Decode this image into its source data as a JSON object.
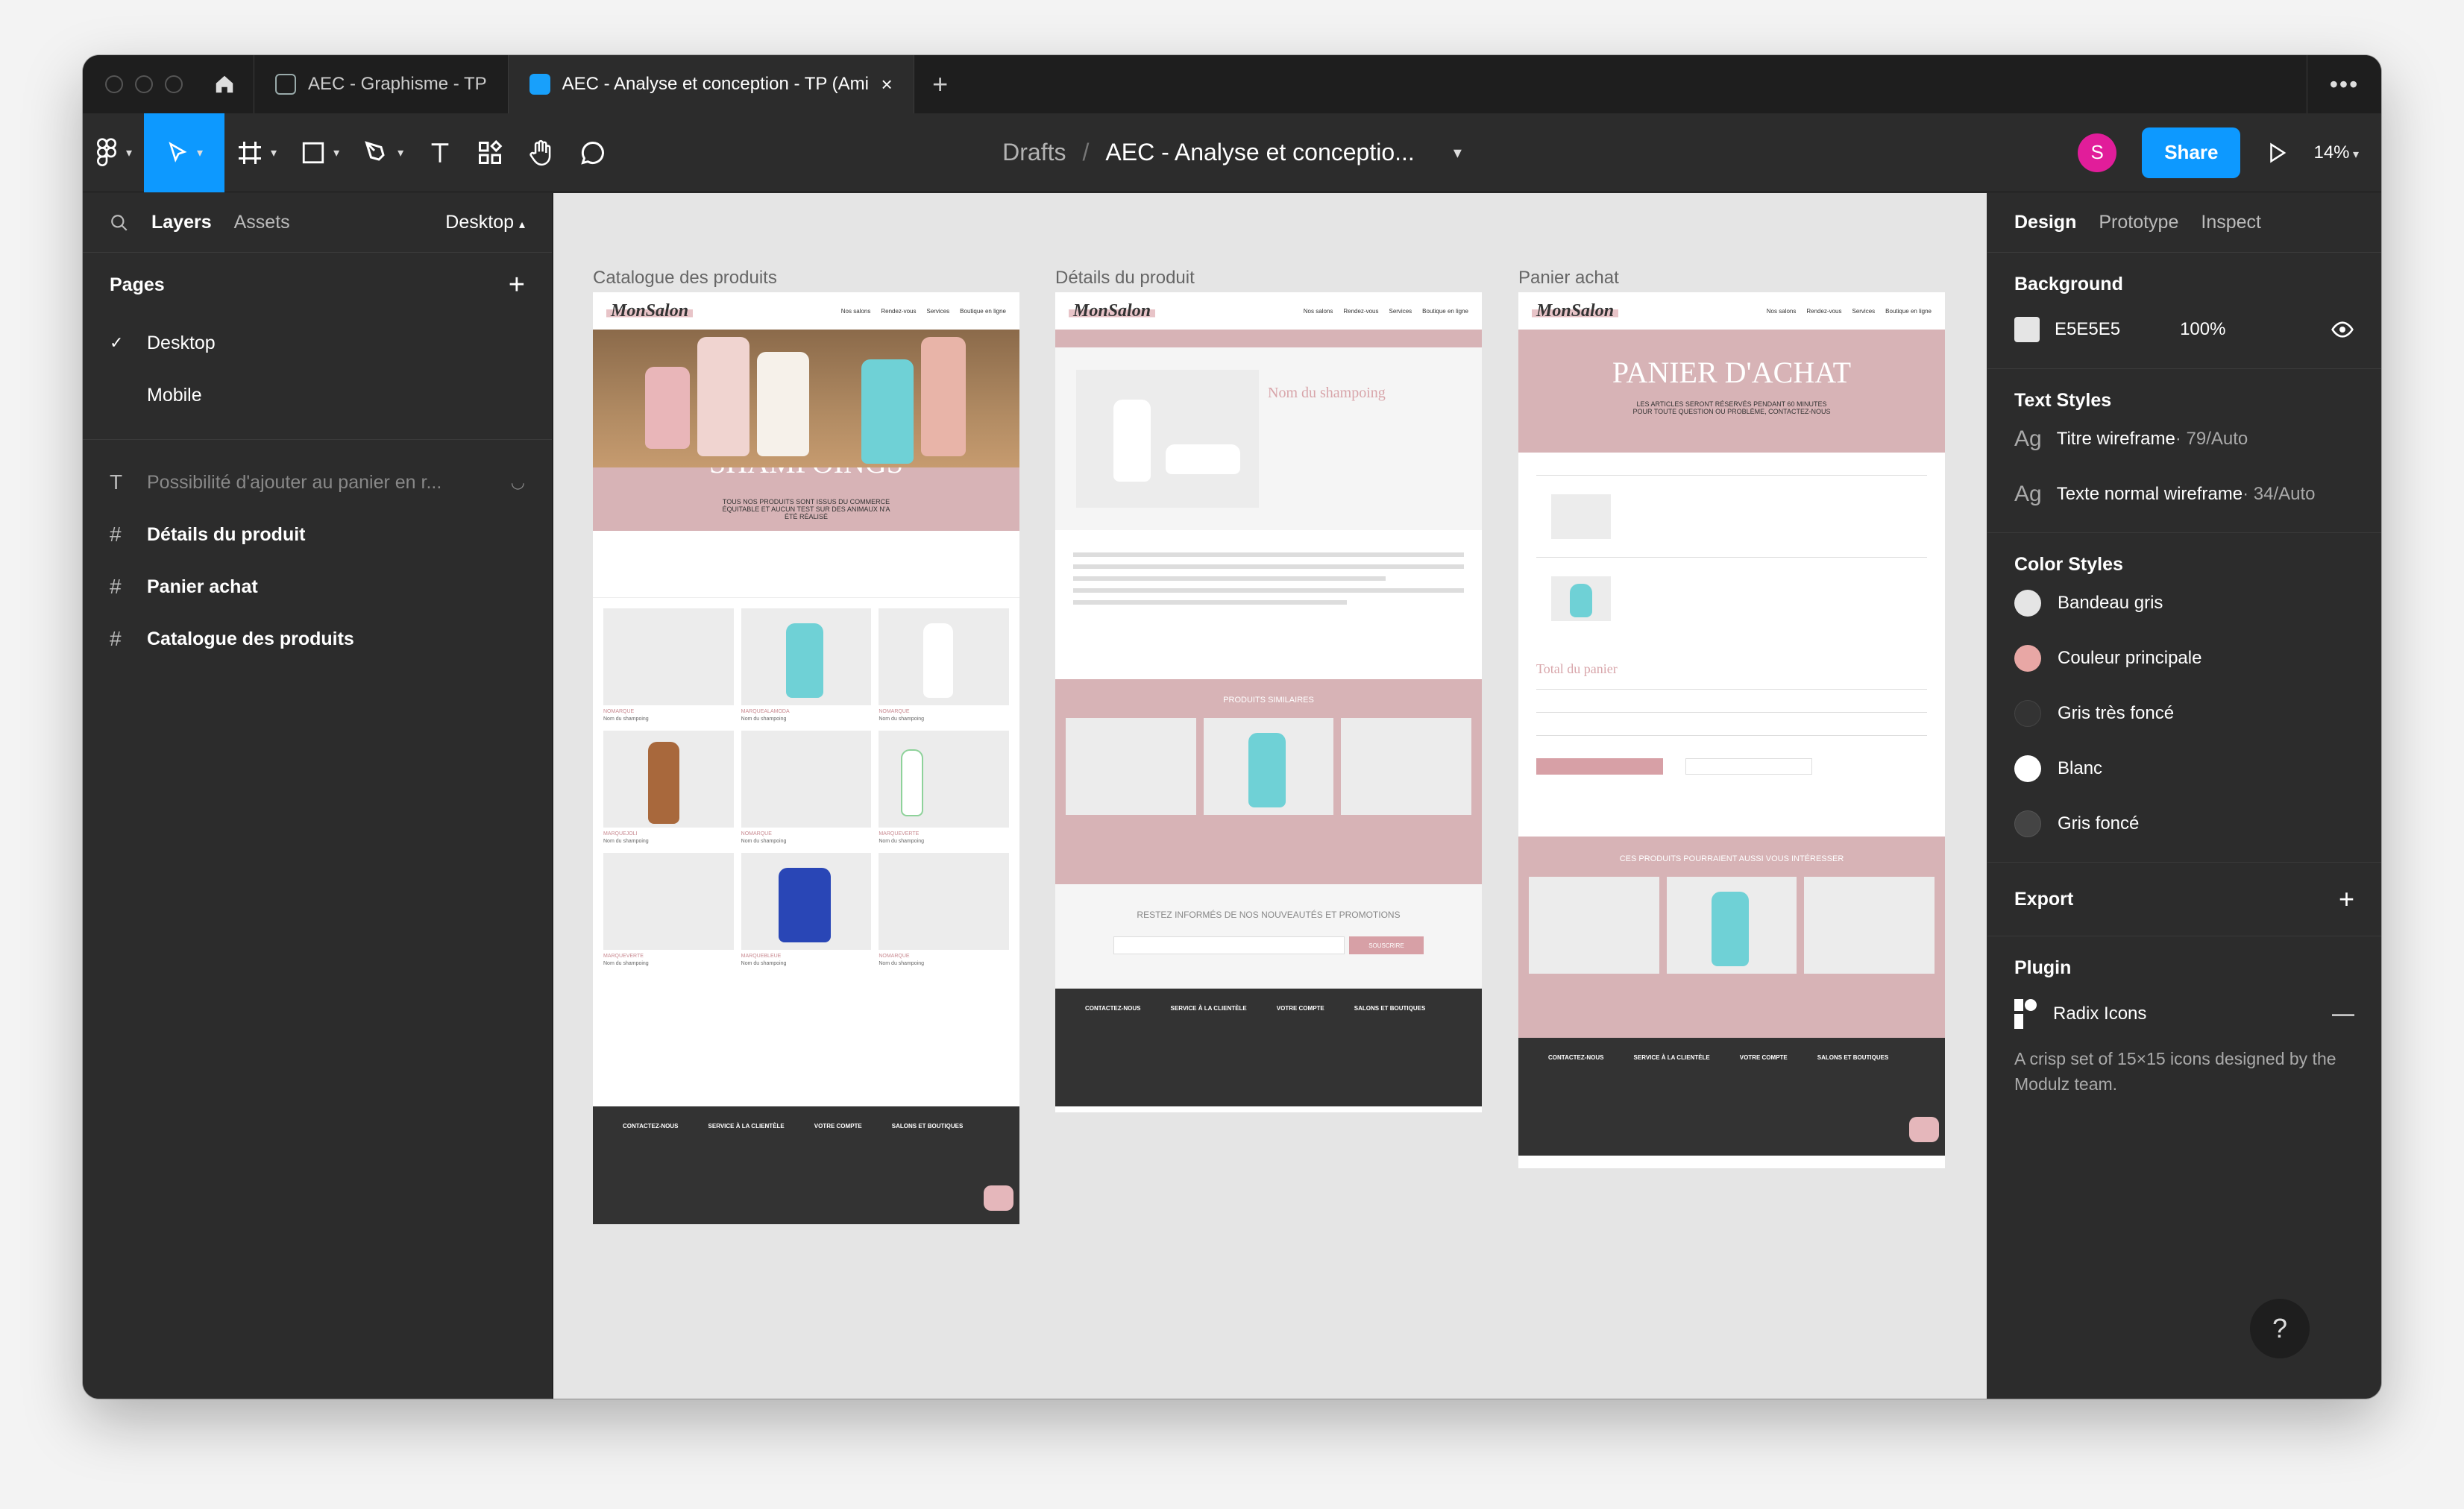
{
  "tabs": {
    "tab1": "AEC - Graphisme - TP",
    "tab2": "AEC - Analyse et conception - TP (Ami"
  },
  "toolbar": {
    "breadcrumb_drafts": "Drafts",
    "breadcrumb_sep": "/",
    "file_title": "AEC - Analyse et conceptio...",
    "avatar_letter": "S",
    "share": "Share",
    "zoom": "14%"
  },
  "left": {
    "tab_layers": "Layers",
    "tab_assets": "Assets",
    "page_selector": "Desktop",
    "pages_header": "Pages",
    "pages": [
      "Desktop",
      "Mobile"
    ],
    "layers": [
      "Possibilité d'ajouter au panier en r...",
      "Détails du produit",
      "Panier achat",
      "Catalogue des produits"
    ]
  },
  "canvas": {
    "frame1_label": "Catalogue des produits",
    "frame2_label": "Détails du produit",
    "frame3_label": "Panier achat",
    "logo": "MonSalon",
    "nav_links": [
      "Nos salons",
      "Rendez-vous",
      "Services",
      "Boutique en ligne"
    ],
    "hero1_title": "SHAMPOINGS",
    "hero1_sub": "TOUS NOS PRODUITS SONT ISSUS DU COMMERCE ÉQUITABLE ET AUCUN TEST SUR DES ANIMAUX N'A ÉTÉ RÉALISÉ",
    "product_name": "Nom du shampoing",
    "similar": "PRODUITS SIMILAIRES",
    "newsletter": "RESTEZ INFORMÉS DE NOS NOUVEAUTÉS ET PROMOTIONS",
    "subscribe": "SOUSCRIRE",
    "cart_title": "PANIER D'ACHAT",
    "cart_sub": "LES ARTICLES SERONT RÉSERVÉS PENDANT 60 MINUTES POUR TOUTE QUESTION OU PROBLÈME, CONTACTEZ-NOUS",
    "cart_total": "Total du panier",
    "cross_sell": "CES PRODUITS POURRAIENT AUSSI VOUS INTÉRESSER",
    "footer_cols": [
      "CONTACTEZ-NOUS",
      "SERVICE À LA CLIENTÈLE",
      "VOTRE COMPTE",
      "SALONS ET BOUTIQUES"
    ]
  },
  "right": {
    "tab_design": "Design",
    "tab_prototype": "Prototype",
    "tab_inspect": "Inspect",
    "background_header": "Background",
    "bg_hex": "E5E5E5",
    "bg_opacity": "100%",
    "bg_color": "#E5E5E5",
    "text_styles_header": "Text Styles",
    "text_styles": [
      {
        "name": "Titre wireframe",
        "meta": " · 79/Auto"
      },
      {
        "name": "Texte normal wireframe",
        "meta": " · 34/Auto"
      }
    ],
    "color_styles_header": "Color Styles",
    "color_styles": [
      {
        "name": "Bandeau gris",
        "color": "#E5E5E5"
      },
      {
        "name": "Couleur principale",
        "color": "#E8A7A5"
      },
      {
        "name": "Gris très foncé",
        "color": "#333333"
      },
      {
        "name": "Blanc",
        "color": "#FFFFFF"
      },
      {
        "name": "Gris foncé",
        "color": "#444444"
      }
    ],
    "export_header": "Export",
    "plugin_header": "Plugin",
    "plugin_name": "Radix Icons",
    "plugin_desc": "A crisp set of 15×15 icons designed by the Modulz team.",
    "help": "?"
  }
}
